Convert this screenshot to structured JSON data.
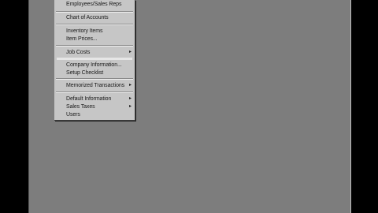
{
  "menu": {
    "items": [
      {
        "label": "Employees/Sales Reps",
        "submenu": false
      },
      {
        "label": "Chart of Accounts",
        "submenu": false
      },
      {
        "label": "Inventory Items",
        "submenu": false
      },
      {
        "label": "Item Prices...",
        "submenu": false
      },
      {
        "label": "Job Costs",
        "submenu": true
      },
      {
        "label": "Company Information...",
        "submenu": false
      },
      {
        "label": "Setup Checklist",
        "submenu": false
      },
      {
        "label": "Memorized Transactions",
        "submenu": true
      },
      {
        "label": "Default Information",
        "submenu": true
      },
      {
        "label": "Sales Taxes",
        "submenu": true
      },
      {
        "label": "Users",
        "submenu": false
      }
    ],
    "submenu_arrow": "▸"
  }
}
